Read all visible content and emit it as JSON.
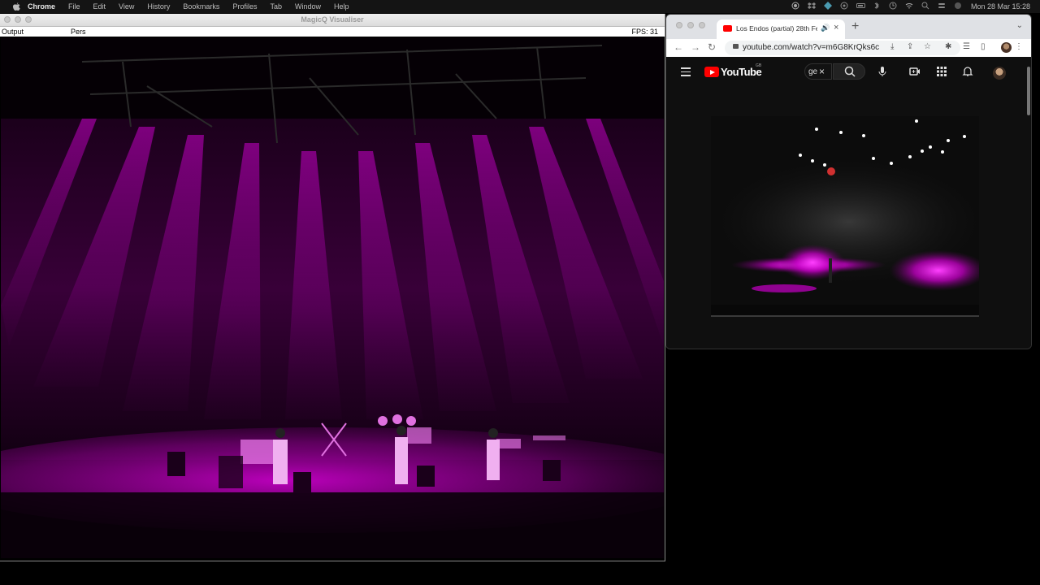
{
  "menubar": {
    "items": [
      "Chrome",
      "File",
      "Edit",
      "View",
      "History",
      "Bookmarks",
      "Profiles",
      "Tab",
      "Window",
      "Help"
    ],
    "clock": "Mon 28 Mar  15:28"
  },
  "magicq": {
    "title": "MagicQ Visualiser",
    "output_label": "Output",
    "view_label": "Pers",
    "fps": "FPS: 31",
    "beam_color": "#cc00cc"
  },
  "chrome": {
    "tab_title": "Los Endos (partial) 28th Fe",
    "url": "youtube.com/watch?v=m6G8KrQks6c"
  },
  "youtube": {
    "wordmark": "YouTube",
    "region": "GB",
    "search_value": "ge"
  }
}
